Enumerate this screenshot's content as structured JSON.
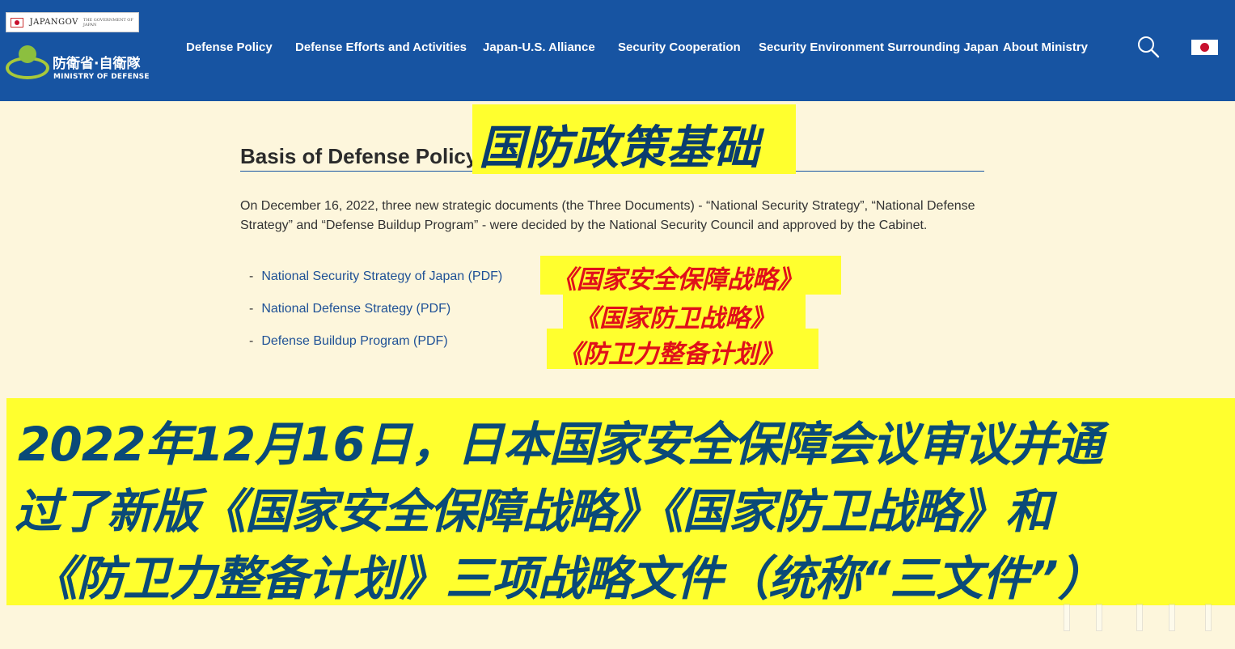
{
  "header": {
    "japangov_label": "JAPANGOV",
    "japangov_sub": "THE GOVERNMENT OF JAPAN",
    "logo_jp": "防衛省·自衛隊",
    "logo_en": "MINISTRY OF DEFENSE",
    "nav": [
      {
        "label": "Defense Policy"
      },
      {
        "label": "Defense Efforts and Activities"
      },
      {
        "label": "Japan-U.S. Alliance"
      },
      {
        "label": "Security Cooperation"
      },
      {
        "label": "Security Environment Surrounding Japan"
      },
      {
        "label": "About Ministry"
      }
    ],
    "bg_color": "#1754a2"
  },
  "main": {
    "title": "Basis of Defense Policy",
    "intro": "On December 16, 2022, three new strategic documents (the Three Documents) - “National Security Strategy”, “National Defense Strategy” and “Defense Buildup Program” - were decided by the National Security Council and approved by the Cabinet.",
    "documents": [
      {
        "label": "National Security Strategy of Japan (PDF)"
      },
      {
        "label": "National Defense Strategy (PDF)"
      },
      {
        "label": "Defense Buildup Program (PDF)"
      }
    ],
    "link_color": "#1f5196"
  },
  "overlay": {
    "title_cn": "国防政策基础",
    "doc_cn": [
      "《国家安全保障战略》",
      "《国家防卫战略》",
      "《防卫力整备计划》"
    ],
    "caption_lines": [
      "2022年12月16日，日本国家安全保障会议审议并通",
      "过了新版《国家安全保障战略》《国家防卫战略》和",
      "《防卫力整备计划》三项战略文件（统称“三文件”）"
    ],
    "highlight_color": "#ffff2e",
    "caption_color": "#0a4a78",
    "red_color": "#e0101a"
  }
}
